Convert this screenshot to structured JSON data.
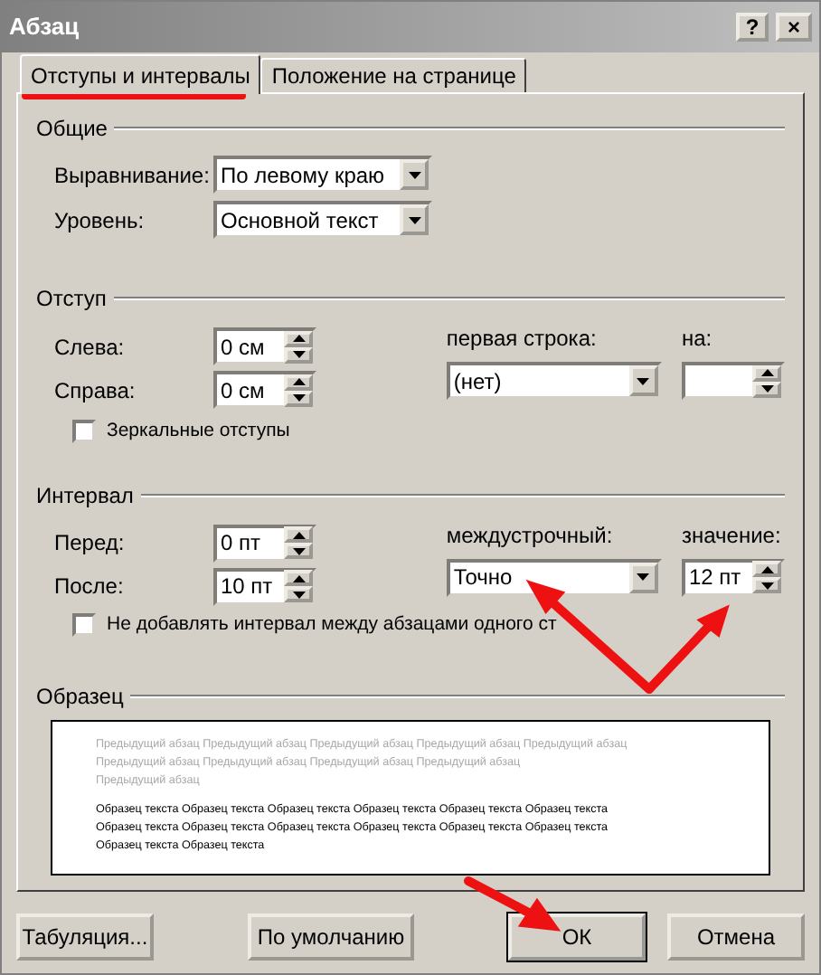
{
  "window": {
    "title": "Абзац",
    "buttons": [
      {
        "kind": "help",
        "label": "?"
      },
      {
        "kind": "close",
        "label": "×"
      }
    ]
  },
  "tabs": [
    {
      "label": "Отступы и интервалы",
      "selected": true
    },
    {
      "label": "Положение на странице",
      "selected": false
    }
  ],
  "general": {
    "title": "Общие",
    "fields": [
      {
        "label": "Выравнивание:",
        "value": "По левому краю"
      },
      {
        "label": "Уровень:",
        "value": "Основной текст"
      }
    ]
  },
  "indent": {
    "title": "Отступ",
    "left": {
      "label": "Слева:",
      "value": "0 см"
    },
    "right": {
      "label": "Справа:",
      "value": "0 см"
    },
    "first_line": {
      "label": "первая строка:",
      "value": "(нет)"
    },
    "by": {
      "label": "на:"
    },
    "mirror": {
      "label": "Зеркальные отступы",
      "checked": false
    }
  },
  "spacing": {
    "title": "Интервал",
    "before": {
      "label": "Перед:",
      "value": "0 пт"
    },
    "after": {
      "label": "После:",
      "value": "10 пт"
    },
    "line": {
      "label": "междустрочный:",
      "value": "Точно"
    },
    "at": {
      "label": "значение:",
      "value": "12 пт"
    },
    "no_space": {
      "label": "Не добавлять интервал между абзацами одного ст",
      "checked": false
    }
  },
  "preview": {
    "title": "Образец",
    "previous": [
      "Предыдущий абзац Предыдущий абзац Предыдущий абзац Предыдущий абзац Предыдущий абзац",
      "Предыдущий абзац Предыдущий абзац Предыдущий абзац Предыдущий абзац",
      "Предыдущий абзац"
    ],
    "sample": [
      "Образец текста Образец текста Образец текста Образец текста Образец текста Образец текста",
      "Образец текста Образец текста Образец текста Образец текста Образец текста Образец текста",
      "Образец текста Образец текста"
    ]
  },
  "buttons": [
    {
      "label": "Табуляция...",
      "default": false
    },
    {
      "label": "По умолчанию",
      "default": false
    },
    {
      "label": "ОК",
      "default": true
    },
    {
      "label": "Отмена",
      "default": false
    }
  ]
}
